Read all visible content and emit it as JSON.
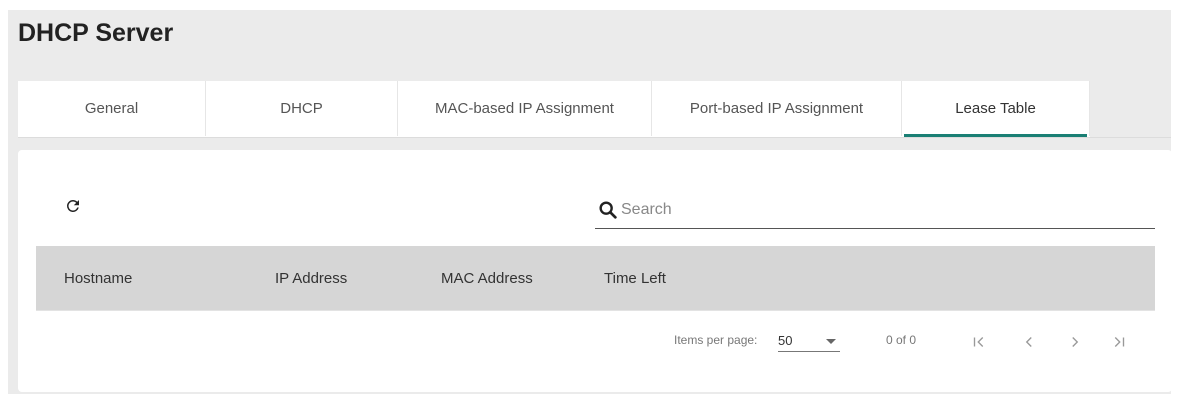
{
  "page": {
    "title": "DHCP Server"
  },
  "tabs": [
    {
      "label": "General"
    },
    {
      "label": "DHCP"
    },
    {
      "label": "MAC-based IP Assignment"
    },
    {
      "label": "Port-based IP Assignment"
    },
    {
      "label": "Lease Table",
      "active": true
    }
  ],
  "toolbar": {
    "refresh_icon": "refresh-icon"
  },
  "search": {
    "placeholder": "Search",
    "value": "",
    "icon": "search-icon"
  },
  "table": {
    "columns": [
      "Hostname",
      "IP Address",
      "MAC Address",
      "Time Left"
    ],
    "rows": []
  },
  "paginator": {
    "items_per_page_label": "Items per page:",
    "items_per_page_value": "50",
    "range_label": "0 of 0",
    "icons": [
      "first-page-icon",
      "previous-page-icon",
      "next-page-icon",
      "last-page-icon"
    ]
  },
  "colors": {
    "accent": "#1a7f74",
    "header_bg": "#d6d6d6",
    "page_bg": "#ebebeb"
  }
}
